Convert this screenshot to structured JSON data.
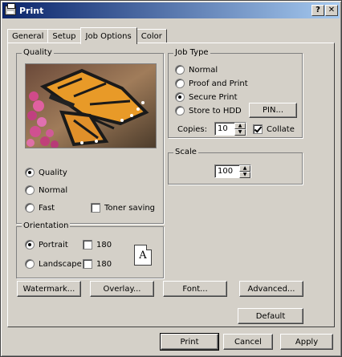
{
  "window": {
    "title": "Print",
    "help_label": "?",
    "close_label": "✕"
  },
  "tabs": [
    {
      "label": "General",
      "active": false
    },
    {
      "label": "Setup",
      "active": false
    },
    {
      "label": "Job Options",
      "active": true
    },
    {
      "label": "Color",
      "active": false
    }
  ],
  "quality": {
    "legend": "Quality",
    "options": [
      "Quality",
      "Normal",
      "Fast"
    ],
    "selected": "Quality",
    "toner_saving_label": "Toner saving",
    "toner_saving_checked": false
  },
  "orientation": {
    "legend": "Orientation",
    "options": [
      "Portrait",
      "Landscape"
    ],
    "selected": "Portrait",
    "rotate_label": "180",
    "portrait_180_checked": false,
    "landscape_180_checked": false,
    "preview_glyph": "A"
  },
  "job_type": {
    "legend": "Job Type",
    "options": [
      "Normal",
      "Proof and Print",
      "Secure Print",
      "Store to HDD"
    ],
    "selected": "Secure Print",
    "pin_label": "PIN...",
    "copies_label": "Copies:",
    "copies_value": "10",
    "collate_label": "Collate",
    "collate_checked": true
  },
  "scale": {
    "legend": "Scale",
    "value": "100"
  },
  "action_buttons": {
    "watermark": "Watermark...",
    "overlay": "Overlay...",
    "font": "Font...",
    "advanced": "Advanced...",
    "default": "Default"
  },
  "footer": {
    "print": "Print",
    "cancel": "Cancel",
    "apply": "Apply"
  }
}
